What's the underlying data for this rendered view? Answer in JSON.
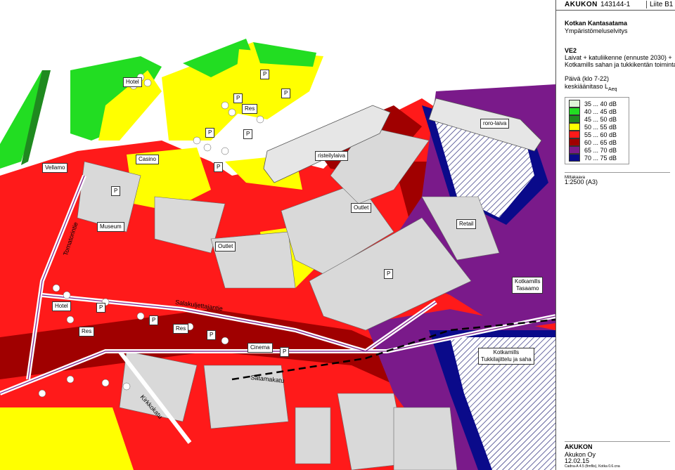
{
  "header": {
    "company": "AKUKON",
    "project_no": "143144-1",
    "attachment": "Liite B1"
  },
  "panel": {
    "title": "Kotkan Kantasatama",
    "subtitle": "Ympäristömeluselvitys",
    "scenario": "VE2",
    "scenario_line1": "Laivat + katuliikenne (ennuste 2030) +",
    "scenario_line2": "Kotkamills sahan ja tukkikentän toiminta",
    "period": "Päivä (klo 7-22)",
    "metric_prefix": "keskiäänitaso L",
    "metric_sub": "Aeq",
    "legend": [
      {
        "label": "35 ... 40 dB",
        "color": "#dff5d8"
      },
      {
        "label": "40 ... 45 dB",
        "color": "#22dd22"
      },
      {
        "label": "45 ... 50 dB",
        "color": "#1f8a1f"
      },
      {
        "label": "50 ... 55 dB",
        "color": "#ffff00"
      },
      {
        "label": "55 ... 60 dB",
        "color": "#ff1a1a"
      },
      {
        "label": "60 ... 65 dB",
        "color": "#a00000"
      },
      {
        "label": "65 ... 70 dB",
        "color": "#7a1a8a"
      },
      {
        "label": "70 ... 75 dB",
        "color": "#0a0a8a"
      }
    ],
    "scale_caption": "Mittakaava",
    "scale": "1:2500 (A3)",
    "footer_company": "Akukon Oy",
    "footer_date": "12.02.15",
    "footer_tiny": "Cadna-A 4.5 (fimflis), Kotka 0.6.cna",
    "footer_logo": "AKUKON"
  },
  "map_labels": {
    "hotel_top": "Hotel",
    "res_top": "Res",
    "casino": "Casino",
    "vellamo": "Vellamo",
    "cruise": "risteilylaiva",
    "roro": "roro-laiva",
    "outlet1": "Outlet",
    "outlet2": "Outlet",
    "museum": "Museum",
    "retail": "Retail",
    "kotkamills_tasaamo_1": "Kotkamills",
    "kotkamills_tasaamo_2": "Tasaamo",
    "hotel_bottom": "Hotel",
    "res_bottom1": "Res",
    "res_bottom2": "Res",
    "cinema": "Cinema",
    "kotkamills_saha_1": "Kotkamills",
    "kotkamills_saha_2": "Tukkilajittelu ja saha",
    "parking": "P"
  },
  "roads": {
    "tornatorintie": "Tornatorintie",
    "salakuljettajantie": "Salakuljettajantie",
    "satamakatu": "Satamakatu",
    "kirkkokatu": "Kirkkokatu"
  }
}
